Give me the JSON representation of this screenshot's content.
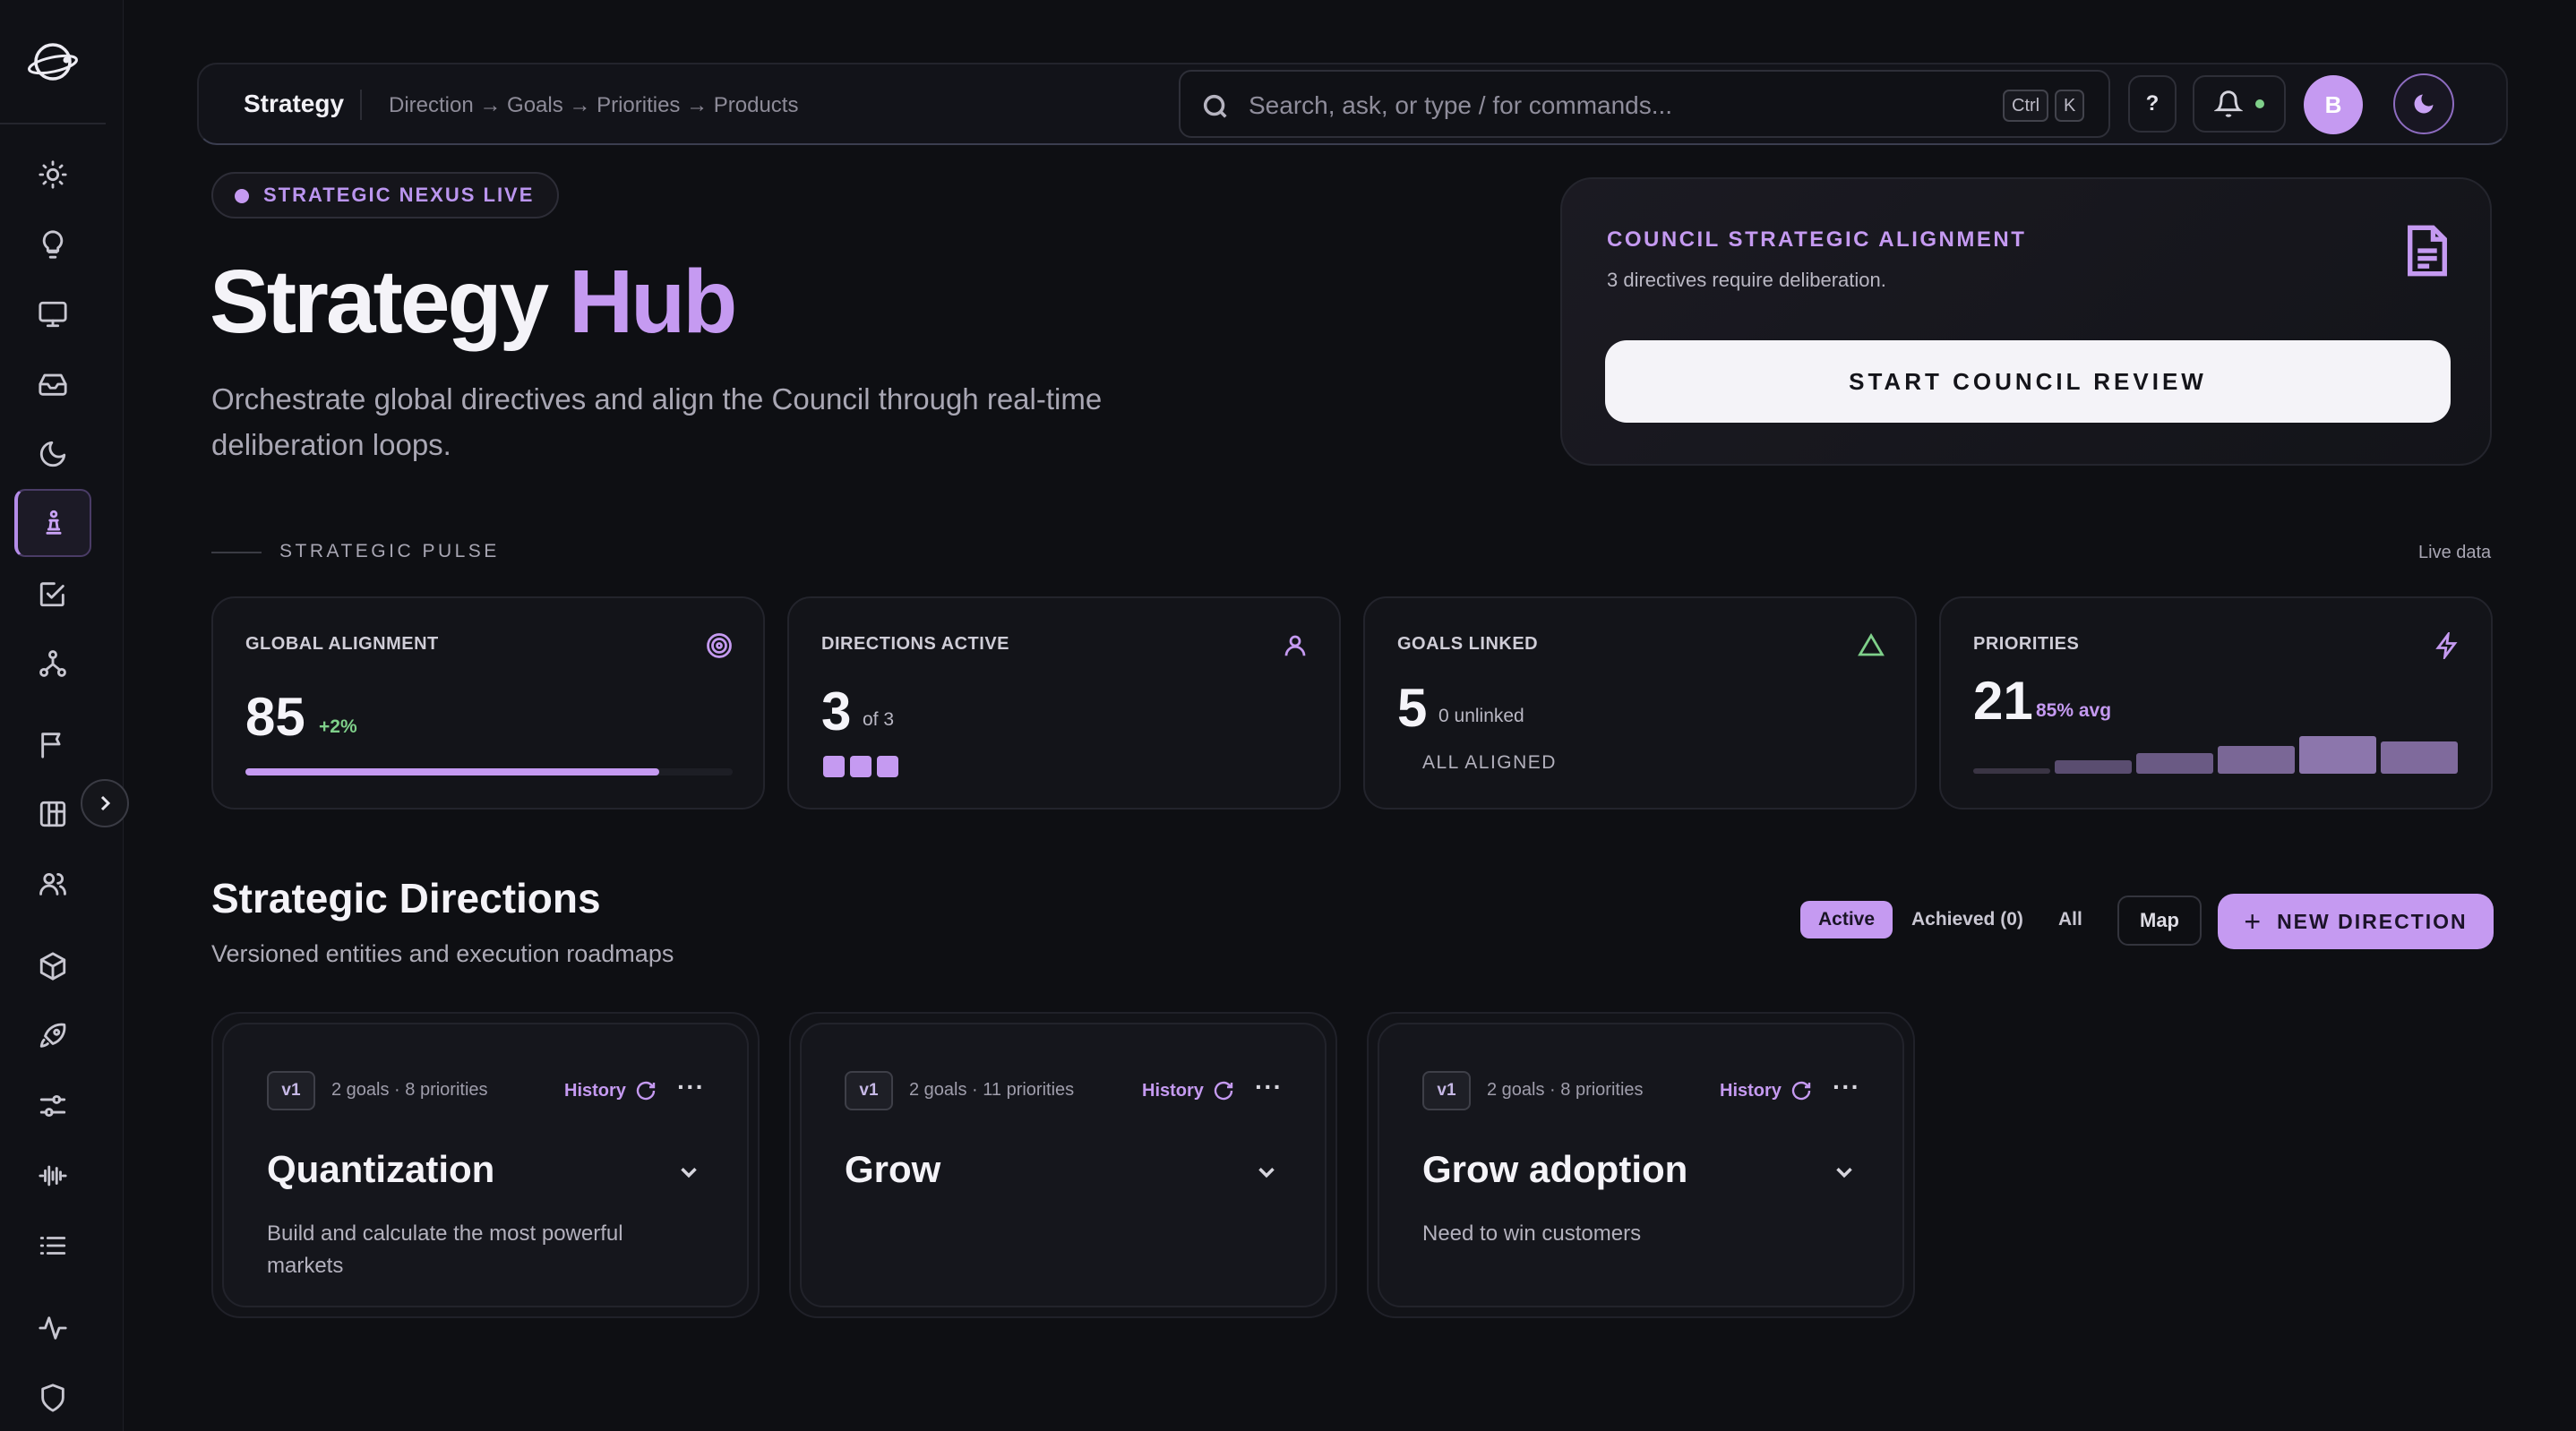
{
  "topbar": {
    "title": "Strategy",
    "breadcrumb": "Direction → Goals → Priorities → Products",
    "search_placeholder": "Search, ask, or type / for commands...",
    "kbd_ctrl": "Ctrl",
    "kbd_k": "K",
    "help_label": "?",
    "avatar_initial": "B"
  },
  "hero": {
    "badge": "STRATEGIC NEXUS LIVE",
    "title_main": "Strategy",
    "title_accent": "Hub",
    "subtitle": "Orchestrate global directives and align the Council through real-time deliberation loops."
  },
  "council": {
    "title": "COUNCIL STRATEGIC ALIGNMENT",
    "subtitle": "3 directives require deliberation.",
    "button": "START COUNCIL REVIEW"
  },
  "pulse": {
    "label": "STRATEGIC PULSE",
    "live": "Live data",
    "stats": [
      {
        "label": "GLOBAL ALIGNMENT",
        "value": "85",
        "delta": "+2%",
        "progress": 0.85
      },
      {
        "label": "DIRECTIONS ACTIVE",
        "value": "3",
        "sub": "of 3",
        "active_count": 3,
        "total": 3
      },
      {
        "label": "GOALS LINKED",
        "value": "5",
        "sub": "0 unlinked",
        "note": "ALL ALIGNED"
      },
      {
        "label": "PRIORITIES",
        "value": "21",
        "sub": "85% avg",
        "trend": [
          0.1,
          0.35,
          0.55,
          0.75,
          1.0,
          0.85
        ]
      }
    ]
  },
  "directions": {
    "title": "Strategic Directions",
    "subtitle": "Versioned entities and execution roadmaps",
    "filters": [
      "Active",
      "Achieved (0)",
      "All"
    ],
    "map_label": "Map",
    "new_label": "NEW DIRECTION",
    "cards": [
      {
        "version": "v1",
        "meta": "2 goals · 8 priorities",
        "history": "History",
        "title": "Quantization",
        "desc": "Build and calculate the most powerful markets"
      },
      {
        "version": "v1",
        "meta": "2 goals · 11 priorities",
        "history": "History",
        "title": "Grow",
        "desc": ""
      },
      {
        "version": "v1",
        "meta": "2 goals · 8 priorities",
        "history": "History",
        "title": "Grow adoption",
        "desc": "Need to win customers"
      }
    ]
  },
  "colors": {
    "accent": "#c59af1",
    "background": "#0e0f13",
    "success": "#7fd08a"
  }
}
